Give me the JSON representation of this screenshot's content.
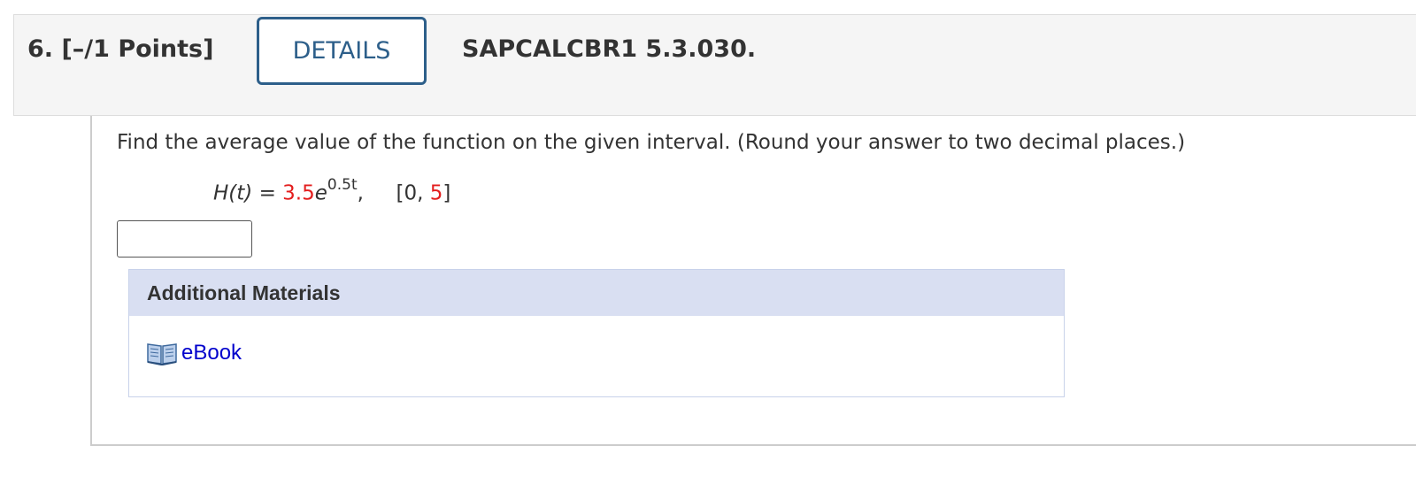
{
  "question": {
    "number_points": "6.  [–/1 Points]",
    "details_label": "DETAILS",
    "code": "SAPCALCBR1 5.3.030."
  },
  "problem": {
    "prompt": "Find the average value of the function on the given interval. (Round your answer to two decimal places.)",
    "formula": {
      "lhs": "H(t)",
      "equals": "=",
      "coefficient": "3.5",
      "base": "e",
      "exponent": "0.5t",
      "comma": ",",
      "interval_open": "[0, ",
      "interval_end": "5",
      "interval_close": "]"
    }
  },
  "answer": {
    "value": "",
    "placeholder": ""
  },
  "materials": {
    "heading": "Additional Materials",
    "ebook_label": "eBook",
    "ebook_icon": "book-icon"
  },
  "colors": {
    "accent": "#2d5f8a",
    "highlight": "#e31e1e",
    "link": "#0000cc",
    "materials_header": "#d9dff2"
  }
}
